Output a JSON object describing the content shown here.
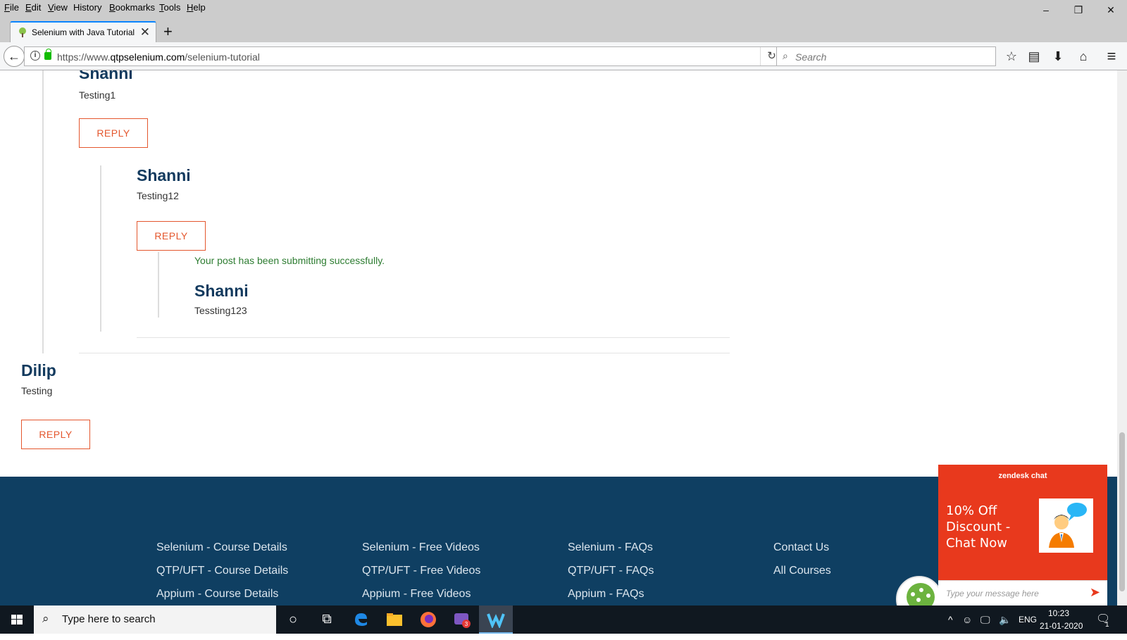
{
  "menubar": {
    "items": [
      {
        "label": "File",
        "access": "F",
        "rest": "ile"
      },
      {
        "label": "Edit",
        "access": "E",
        "rest": "dit"
      },
      {
        "label": "View",
        "access": "V",
        "rest": "iew"
      },
      {
        "label": "History",
        "access": "",
        "rest": "History"
      },
      {
        "label": "Bookmarks",
        "access": "B",
        "rest": "ookmarks"
      },
      {
        "label": "Tools",
        "access": "T",
        "rest": "ools"
      },
      {
        "label": "Help",
        "access": "H",
        "rest": "elp"
      }
    ],
    "minimize": "–",
    "restore": "❐",
    "close": "✕"
  },
  "tab": {
    "title": "Selenium with Java Tutorial F",
    "close_glyph": "✕",
    "new_tab_glyph": "+"
  },
  "navbar": {
    "back_glyph": "←",
    "url_prefix": "https://www.",
    "url_domain": "qtpselenium.com",
    "url_path": "/selenium-tutorial",
    "reload_glyph": "↻",
    "search_placeholder": "Search",
    "bookmark_glyph": "☆",
    "library_glyph": "▤",
    "download_glyph": "⬇",
    "home_glyph": "⌂",
    "menu_glyph": "≡"
  },
  "comments": {
    "c1": {
      "author": "Shanni",
      "text": "Testing1",
      "reply": "REPLY"
    },
    "c2": {
      "author": "Shanni",
      "text": "Testing12",
      "reply": "REPLY"
    },
    "success_message": "Your post has been submitting successfully.",
    "c3": {
      "author": "Shanni",
      "text": "Tessting123"
    },
    "c4": {
      "author": "Dilip",
      "text": "Testing",
      "reply": "REPLY"
    }
  },
  "footer": {
    "col1": [
      "Selenium - Course Details",
      "QTP/UFT - Course Details",
      "Appium - Course Details"
    ],
    "col2": [
      "Selenium - Free Videos",
      "QTP/UFT - Free Videos",
      "Appium - Free Videos"
    ],
    "col3": [
      "Selenium - FAQs",
      "QTP/UFT - FAQs",
      "Appium - FAQs"
    ],
    "col4": [
      "Contact Us",
      "All Courses"
    ],
    "background": "#0f3f62"
  },
  "zendesk": {
    "brand": "zendesk chat",
    "promo": "10% Off Discount - Chat Now",
    "placeholder": "Type your message here",
    "send_glyph": "➤",
    "color": "#e8391d"
  },
  "taskbar": {
    "search_placeholder": "Type here to search",
    "cortana_glyph": "○",
    "taskview_glyph": "⧉",
    "tray_chevron": "^",
    "language": "ENG",
    "time": "10:23",
    "date": "21-01-2020",
    "notification_count": "1",
    "chat_badge": "3"
  },
  "colors": {
    "accent_reply": "#e4572e",
    "author_name": "#123a5e",
    "success_green": "#2e7d32"
  }
}
